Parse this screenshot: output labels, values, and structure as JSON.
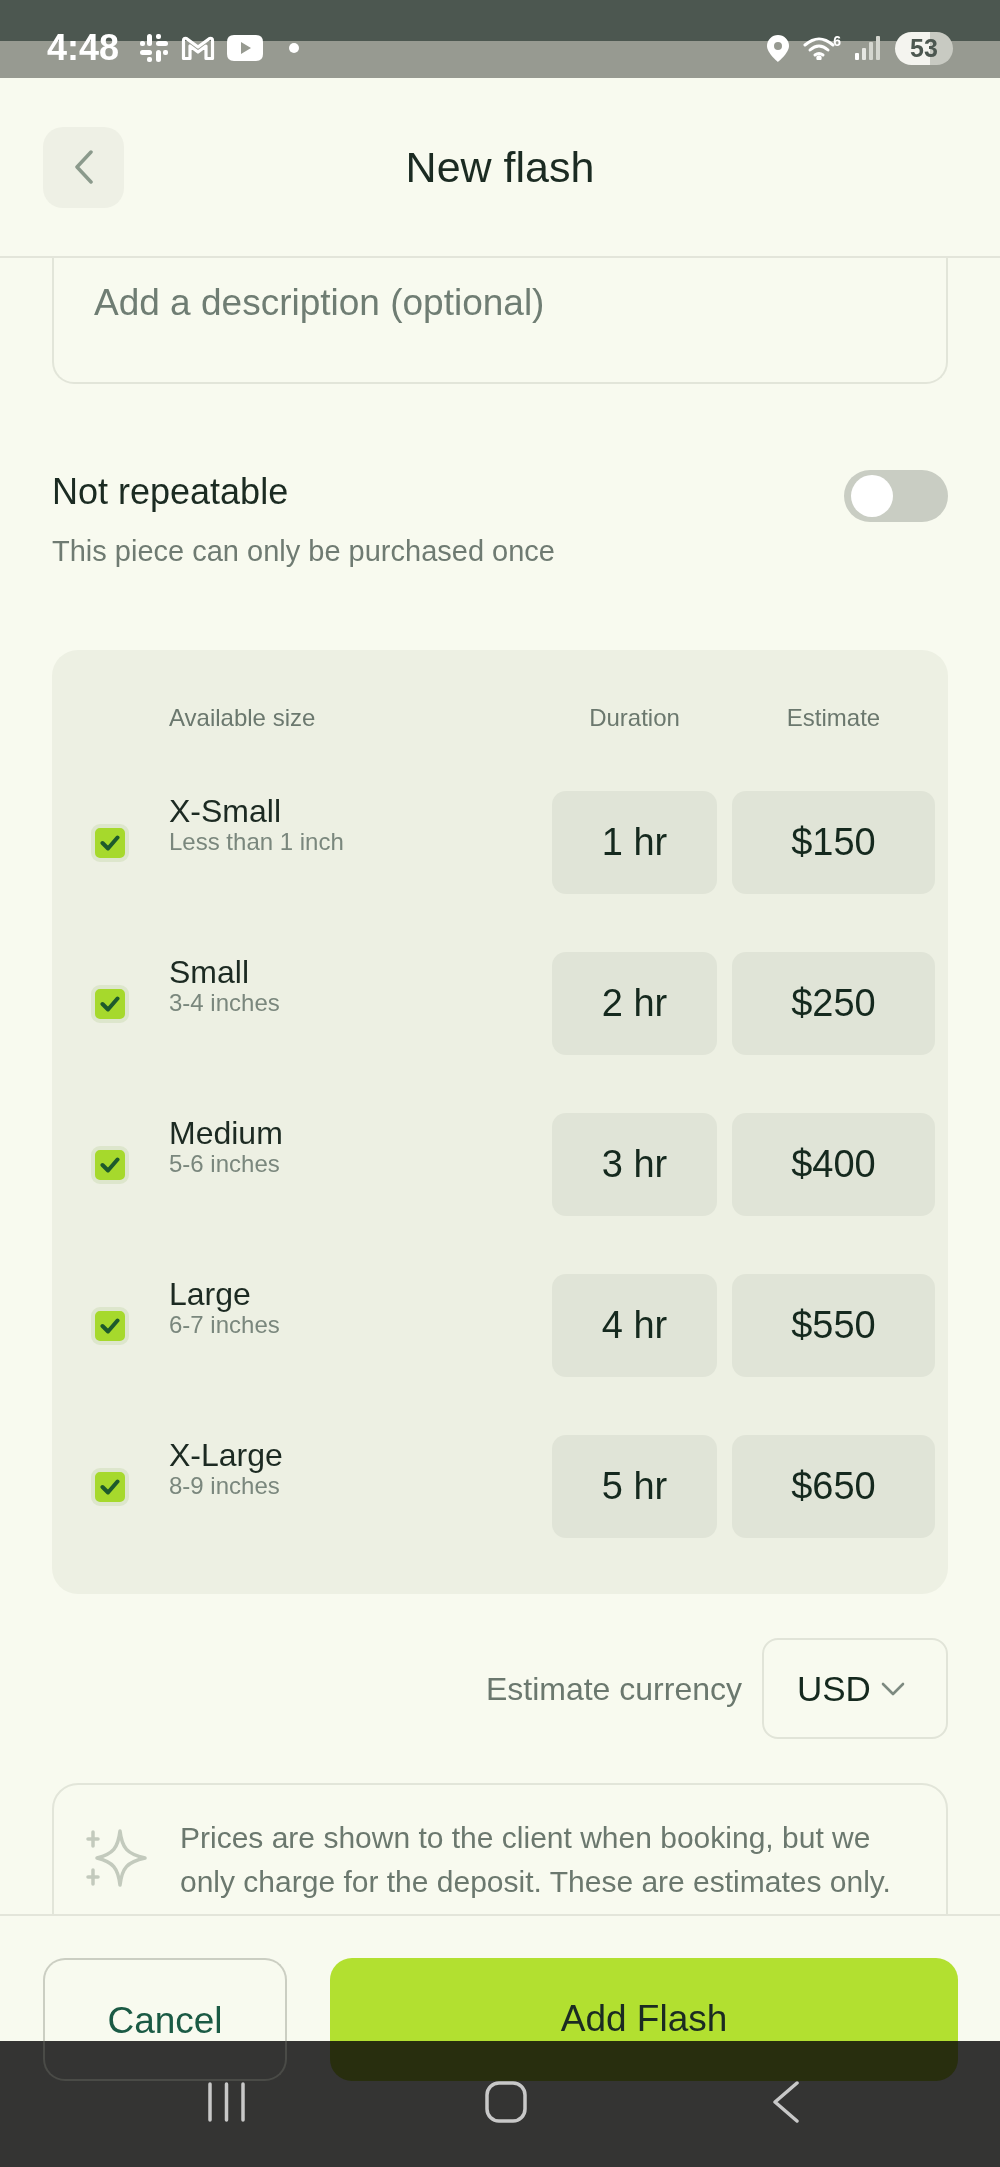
{
  "status_bar": {
    "time": "4:48",
    "wifi_label": "6",
    "battery": "53"
  },
  "header": {
    "title": "New flash"
  },
  "description": {
    "placeholder": "Add a description (optional)"
  },
  "repeat_setting": {
    "label": "Not repeatable",
    "hint": "This piece can only be purchased once",
    "on": false
  },
  "sizes_table": {
    "columns": [
      "Available size",
      "Duration",
      "Estimate"
    ],
    "rows": [
      {
        "checked": true,
        "name": "X-Small",
        "range": "Less than 1 inch",
        "duration": "1 hr",
        "estimate": "$150"
      },
      {
        "checked": true,
        "name": "Small",
        "range": "3-4 inches",
        "duration": "2 hr",
        "estimate": "$250"
      },
      {
        "checked": true,
        "name": "Medium",
        "range": "5-6 inches",
        "duration": "3 hr",
        "estimate": "$400"
      },
      {
        "checked": true,
        "name": "Large",
        "range": "6-7 inches",
        "duration": "4 hr",
        "estimate": "$550"
      },
      {
        "checked": true,
        "name": "X-Large",
        "range": "8-9 inches",
        "duration": "5 hr",
        "estimate": "$650"
      }
    ]
  },
  "currency": {
    "label": "Estimate currency",
    "value": "USD"
  },
  "notice": {
    "text": "Prices are shown to the client when booking, but we only charge for the deposit. These are estimates only."
  },
  "footer": {
    "buttons": [
      {
        "label": "Cancel",
        "kind": "secondary"
      },
      {
        "label": "Add Flash",
        "kind": "primary"
      }
    ]
  }
}
